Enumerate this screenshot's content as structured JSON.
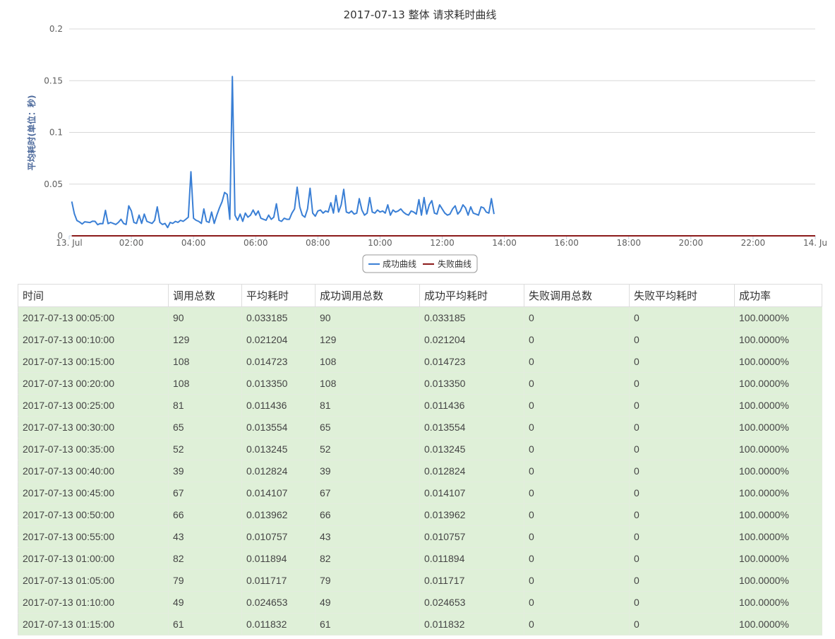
{
  "chart_data": {
    "type": "line",
    "title": "2017-07-13 整体 请求耗时曲线",
    "ylabel": "平均耗时(单位：秒)",
    "xlabel": "",
    "ylim": [
      0,
      0.2
    ],
    "yticks": [
      "0",
      "0.05",
      "0.1",
      "0.15",
      "0.2"
    ],
    "xlim_hours": [
      0,
      24
    ],
    "xtick_labels": [
      "13. Jul",
      "02:00",
      "04:00",
      "06:00",
      "08:00",
      "10:00",
      "12:00",
      "14:00",
      "16:00",
      "18:00",
      "20:00",
      "22:00",
      "14. Ju"
    ],
    "grid": true,
    "legend_position": "bottom-center",
    "series": [
      {
        "name": "成功曲线",
        "color": "#3a7fd5",
        "x_hours": [
          0.083,
          0.167,
          0.25,
          0.333,
          0.417,
          0.5,
          0.583,
          0.667,
          0.75,
          0.833,
          0.917,
          1.0,
          1.083,
          1.167,
          1.25,
          1.333,
          1.417,
          1.5,
          1.583,
          1.667,
          1.75,
          1.833,
          1.917,
          2.0,
          2.083,
          2.167,
          2.25,
          2.333,
          2.417,
          2.5,
          2.583,
          2.667,
          2.75,
          2.833,
          2.917,
          3.0,
          3.083,
          3.167,
          3.25,
          3.333,
          3.417,
          3.5,
          3.583,
          3.667,
          3.75,
          3.833,
          3.917,
          4.0,
          4.083,
          4.167,
          4.25,
          4.333,
          4.417,
          4.5,
          4.583,
          4.667,
          4.75,
          4.833,
          4.917,
          5.0,
          5.083,
          5.167,
          5.25,
          5.333,
          5.417,
          5.5,
          5.583,
          5.667,
          5.75,
          5.833,
          5.917,
          6.0,
          6.083,
          6.167,
          6.25,
          6.333,
          6.417,
          6.5,
          6.583,
          6.667,
          6.75,
          6.833,
          6.917,
          7.0,
          7.083,
          7.167,
          7.25,
          7.333,
          7.417,
          7.5,
          7.583,
          7.667,
          7.75,
          7.833,
          7.917,
          8.0,
          8.083,
          8.167,
          8.25,
          8.333,
          8.417,
          8.5,
          8.583,
          8.667,
          8.75,
          8.833,
          8.917,
          9.0,
          9.083,
          9.167,
          9.25,
          9.333,
          9.417,
          9.5,
          9.583,
          9.667,
          9.75,
          9.833,
          9.917,
          10.0,
          10.083,
          10.167,
          10.25,
          10.333,
          10.417,
          10.5,
          10.583,
          10.667,
          10.75,
          10.833,
          10.917,
          11.0,
          11.083,
          11.167,
          11.25,
          11.333,
          11.417,
          11.5,
          11.583,
          11.667,
          11.75,
          11.833,
          11.917,
          12.0,
          12.083,
          12.167,
          12.25,
          12.333,
          12.417,
          12.5,
          12.583,
          12.667,
          12.75,
          12.833,
          12.917,
          13.0,
          13.083,
          13.167,
          13.25,
          13.333,
          13.417,
          13.5,
          13.583,
          13.667,
          13.75,
          13.833,
          13.917,
          14.0,
          14.083,
          14.167,
          14.25
        ],
        "y": [
          0.033185,
          0.021204,
          0.014723,
          0.01335,
          0.011436,
          0.013554,
          0.013245,
          0.012824,
          0.014107,
          0.013962,
          0.010757,
          0.011894,
          0.011717,
          0.024653,
          0.011832,
          0.013,
          0.012,
          0.011,
          0.013,
          0.016,
          0.012,
          0.011,
          0.029,
          0.024,
          0.013,
          0.012,
          0.02,
          0.012,
          0.021,
          0.014,
          0.013,
          0.012,
          0.015,
          0.028,
          0.013,
          0.011,
          0.012,
          0.008,
          0.013,
          0.012,
          0.014,
          0.013,
          0.015,
          0.014,
          0.016,
          0.018,
          0.062,
          0.017,
          0.015,
          0.014,
          0.012,
          0.026,
          0.014,
          0.013,
          0.023,
          0.012,
          0.02,
          0.027,
          0.033,
          0.042,
          0.04,
          0.016,
          0.154,
          0.02,
          0.015,
          0.021,
          0.014,
          0.022,
          0.018,
          0.02,
          0.025,
          0.02,
          0.024,
          0.017,
          0.016,
          0.015,
          0.02,
          0.016,
          0.018,
          0.031,
          0.015,
          0.014,
          0.017,
          0.016,
          0.016,
          0.022,
          0.026,
          0.047,
          0.028,
          0.02,
          0.018,
          0.026,
          0.046,
          0.022,
          0.019,
          0.024,
          0.025,
          0.022,
          0.024,
          0.023,
          0.032,
          0.022,
          0.039,
          0.023,
          0.03,
          0.045,
          0.023,
          0.022,
          0.024,
          0.021,
          0.022,
          0.036,
          0.025,
          0.02,
          0.022,
          0.037,
          0.023,
          0.022,
          0.025,
          0.023,
          0.024,
          0.022,
          0.03,
          0.02,
          0.025,
          0.023,
          0.024,
          0.026,
          0.023,
          0.021,
          0.02,
          0.024,
          0.023,
          0.021,
          0.035,
          0.02,
          0.037,
          0.021,
          0.03,
          0.034,
          0.022,
          0.021,
          0.03,
          0.026,
          0.022,
          0.02,
          0.021,
          0.026,
          0.029,
          0.021,
          0.024,
          0.03,
          0.027,
          0.02,
          0.028,
          0.022,
          0.021,
          0.02,
          0.028,
          0.027,
          0.023,
          0.022,
          0.036,
          0.021
        ]
      },
      {
        "name": "失败曲线",
        "color": "#8b1a1a",
        "x_hours": [
          0.083,
          24.0
        ],
        "y": [
          0,
          0
        ]
      }
    ]
  },
  "table": {
    "headers": [
      "时间",
      "调用总数",
      "平均耗时",
      "成功调用总数",
      "成功平均耗时",
      "失败调用总数",
      "失败平均耗时",
      "成功率"
    ],
    "rows": [
      [
        "2017-07-13 00:05:00",
        "90",
        "0.033185",
        "90",
        "0.033185",
        "0",
        "0",
        "100.0000%"
      ],
      [
        "2017-07-13 00:10:00",
        "129",
        "0.021204",
        "129",
        "0.021204",
        "0",
        "0",
        "100.0000%"
      ],
      [
        "2017-07-13 00:15:00",
        "108",
        "0.014723",
        "108",
        "0.014723",
        "0",
        "0",
        "100.0000%"
      ],
      [
        "2017-07-13 00:20:00",
        "108",
        "0.013350",
        "108",
        "0.013350",
        "0",
        "0",
        "100.0000%"
      ],
      [
        "2017-07-13 00:25:00",
        "81",
        "0.011436",
        "81",
        "0.011436",
        "0",
        "0",
        "100.0000%"
      ],
      [
        "2017-07-13 00:30:00",
        "65",
        "0.013554",
        "65",
        "0.013554",
        "0",
        "0",
        "100.0000%"
      ],
      [
        "2017-07-13 00:35:00",
        "52",
        "0.013245",
        "52",
        "0.013245",
        "0",
        "0",
        "100.0000%"
      ],
      [
        "2017-07-13 00:40:00",
        "39",
        "0.012824",
        "39",
        "0.012824",
        "0",
        "0",
        "100.0000%"
      ],
      [
        "2017-07-13 00:45:00",
        "67",
        "0.014107",
        "67",
        "0.014107",
        "0",
        "0",
        "100.0000%"
      ],
      [
        "2017-07-13 00:50:00",
        "66",
        "0.013962",
        "66",
        "0.013962",
        "0",
        "0",
        "100.0000%"
      ],
      [
        "2017-07-13 00:55:00",
        "43",
        "0.010757",
        "43",
        "0.010757",
        "0",
        "0",
        "100.0000%"
      ],
      [
        "2017-07-13 01:00:00",
        "82",
        "0.011894",
        "82",
        "0.011894",
        "0",
        "0",
        "100.0000%"
      ],
      [
        "2017-07-13 01:05:00",
        "79",
        "0.011717",
        "79",
        "0.011717",
        "0",
        "0",
        "100.0000%"
      ],
      [
        "2017-07-13 01:10:00",
        "49",
        "0.024653",
        "49",
        "0.024653",
        "0",
        "0",
        "100.0000%"
      ],
      [
        "2017-07-13 01:15:00",
        "61",
        "0.011832",
        "61",
        "0.011832",
        "0",
        "0",
        "100.0000%"
      ]
    ]
  }
}
